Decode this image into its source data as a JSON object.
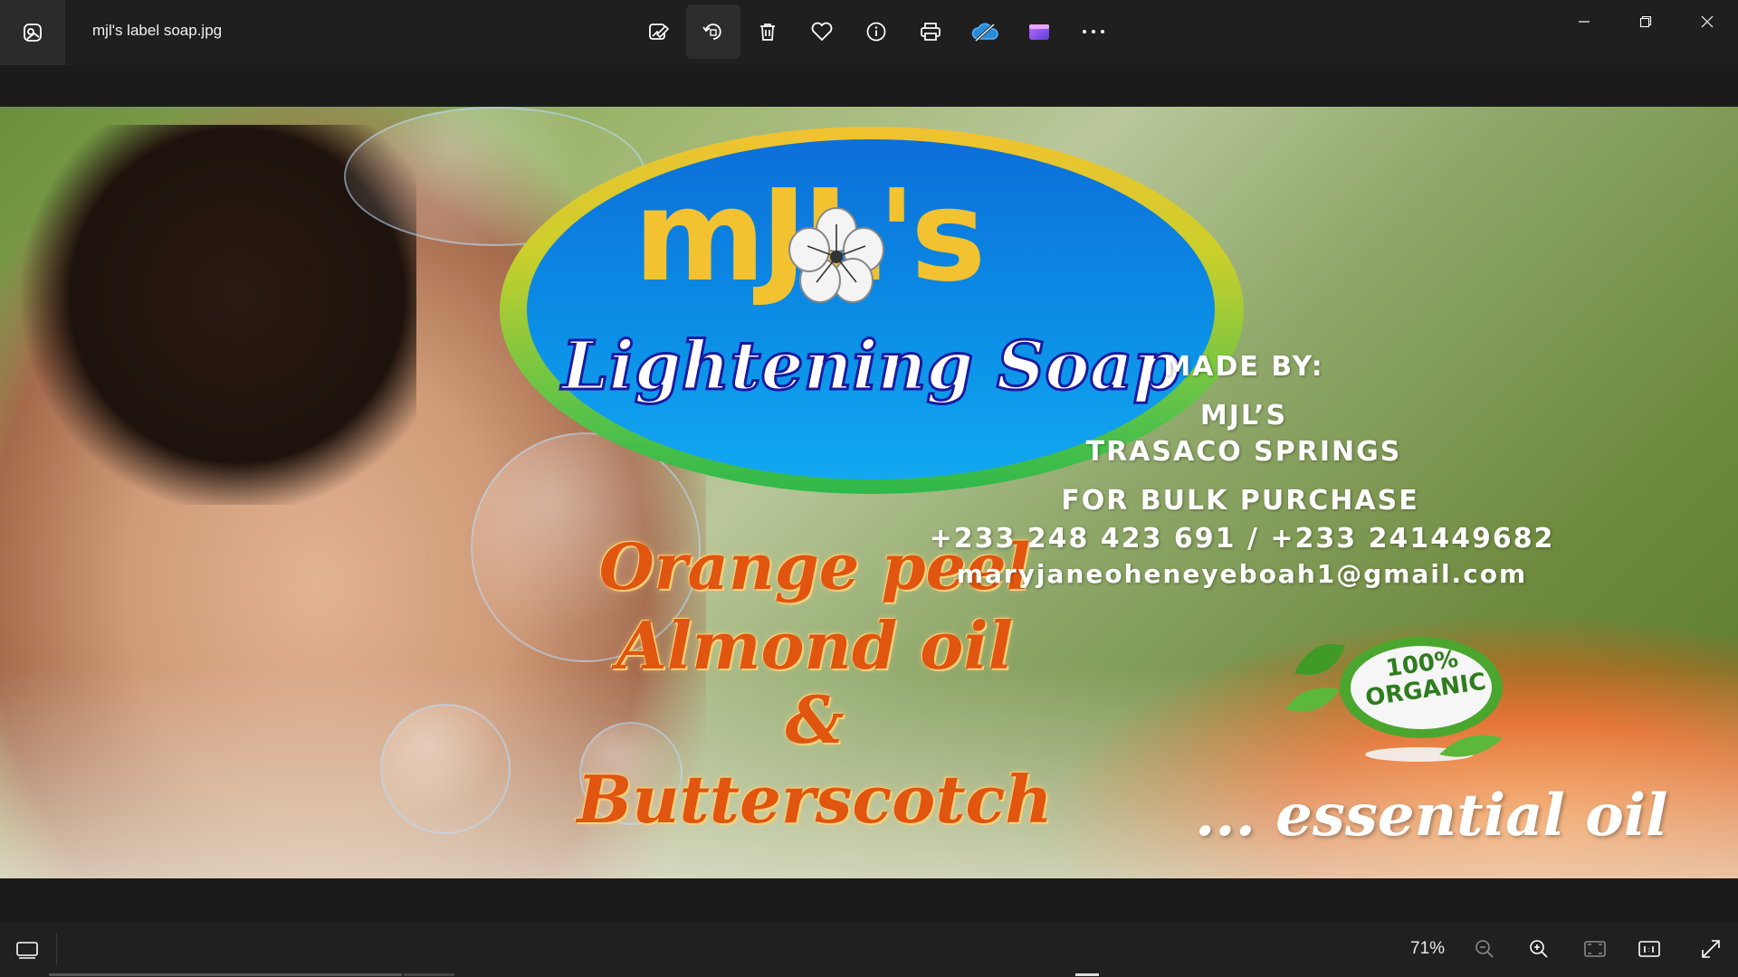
{
  "window": {
    "file_name": "mjl's label soap.jpg"
  },
  "toolbar": {
    "items": [
      {
        "name": "edit-image",
        "icon": "edit-image-icon"
      },
      {
        "name": "rotate",
        "icon": "rotate-icon",
        "active": true
      },
      {
        "name": "delete",
        "icon": "trash-icon"
      },
      {
        "name": "favorite",
        "icon": "heart-icon"
      },
      {
        "name": "info",
        "icon": "info-icon"
      },
      {
        "name": "print",
        "icon": "printer-icon"
      },
      {
        "name": "onedrive",
        "icon": "cloud-icon"
      },
      {
        "name": "clipchamp",
        "icon": "video-editor-icon"
      },
      {
        "name": "more",
        "icon": "more-icon"
      }
    ]
  },
  "image": {
    "brand": "mJL's",
    "product": "Lightening Soap",
    "scent_line1": "Orange peel",
    "scent_line2": "Almond oil",
    "scent_line3": "&",
    "scent_line4": "Butterscotch",
    "made_by_label": "MADE BY:",
    "maker_line1": "MJL’S",
    "maker_line2": "TRASACO SPRINGS",
    "bulk_label": "FOR BULK PURCHASE",
    "phones": "+233 248 423 691 / +233 241449682",
    "email": "maryjaneoheneyeboah1@gmail.com",
    "organic_line1": "100%",
    "organic_line2": "ORGANIC",
    "essential": "... essential oil"
  },
  "statusbar": {
    "zoom": "71%"
  },
  "colors": {
    "chrome_bg": "#1f1f1f",
    "brand_yellow": "#f2c230",
    "logo_blue": "#0b8ee6",
    "scent_orange": "#e0550f",
    "organic_green": "#2e7d1e"
  }
}
